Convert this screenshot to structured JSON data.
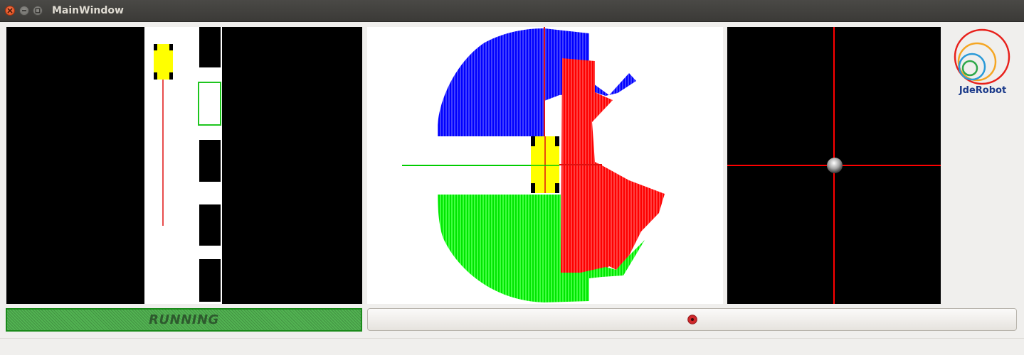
{
  "window": {
    "title": "MainWindow"
  },
  "logo": {
    "text": "JdeRobot"
  },
  "status": {
    "label": "RUNNING"
  },
  "icons": {
    "close": "close-icon",
    "minimize": "minimize-icon",
    "maximize": "maximize-icon",
    "record": "record-icon",
    "car": "car-icon",
    "joystick": "joystick-ball-icon"
  },
  "colors": {
    "titlebar": "#3c3b37",
    "laser_front_left": "#0000ff",
    "laser_right": "#ff0000",
    "laser_rear": "#00ff00",
    "car": "#ffff00",
    "status_green": "#52b352",
    "record_red": "#d0282b"
  }
}
